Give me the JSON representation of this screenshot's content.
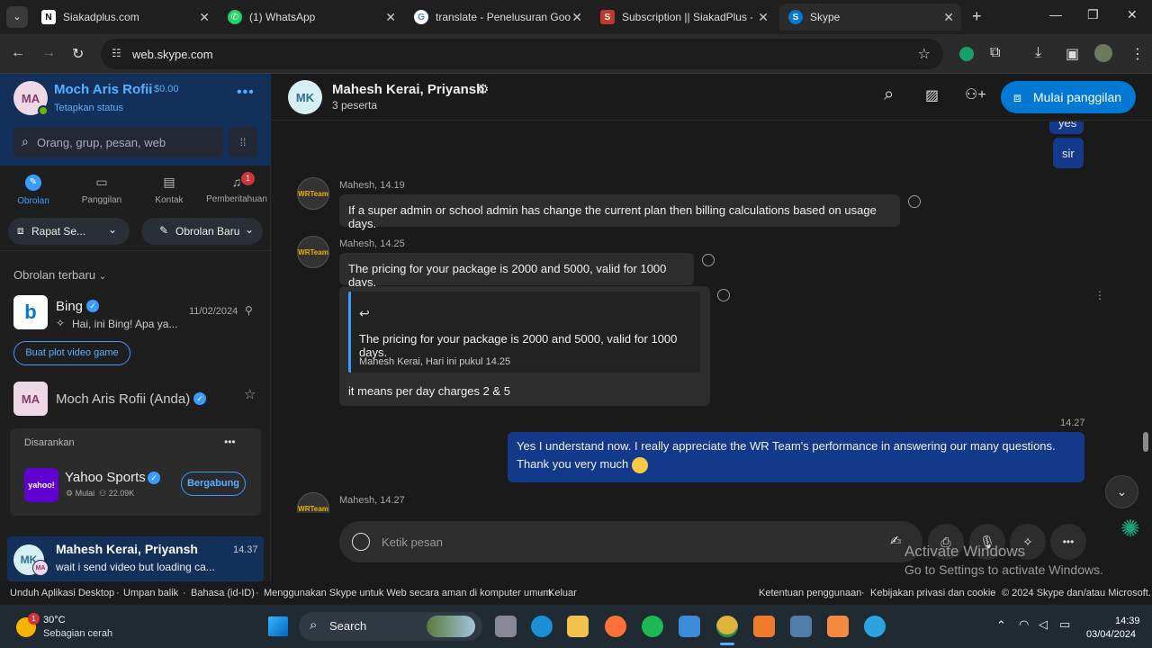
{
  "tabs": [
    {
      "title": "Siakadplus.com",
      "icon": "n-icon",
      "color": "#3a3a3a"
    },
    {
      "title": "(1) WhatsApp",
      "icon": "whatsapp-icon",
      "color": "#25d366"
    },
    {
      "title": "translate - Penelusuran Goo",
      "icon": "google-icon",
      "color": "#4285f4"
    },
    {
      "title": "Subscription || SiakadPlus - S",
      "icon": "siakad-icon",
      "color": "#c0392b"
    },
    {
      "title": "Skype",
      "icon": "skype-icon",
      "color": "#0078d4"
    }
  ],
  "url": "web.skype.com",
  "profile": {
    "initials": "MA",
    "name": "Moch Aris Rofii",
    "credit": "$0.00",
    "status": "Tetapkan status"
  },
  "search_placeholder": "Orang, grup, pesan, web",
  "nav": [
    {
      "label": "Obrolan",
      "icon": "chat-icon"
    },
    {
      "label": "Panggilan",
      "icon": "video-icon"
    },
    {
      "label": "Kontak",
      "icon": "contacts-icon"
    },
    {
      "label": "Pemberitahuan",
      "icon": "bell-icon",
      "badge": "1"
    }
  ],
  "meet_button": "Rapat Se...",
  "new_chat_button": "Obrolan Baru",
  "recent_header": "Obrolan terbaru",
  "bing": {
    "name": "Bing",
    "date": "11/02/2024",
    "preview": "Hai, ini Bing! Apa ya...",
    "chip": "Buat plot video game"
  },
  "self_chat": {
    "initials": "MA",
    "name": "Moch Aris Rofii (Anda)"
  },
  "suggested": {
    "header": "Disarankan",
    "name": "Yahoo Sports",
    "logo": "yahoo!",
    "sub1": "Mulai",
    "sub2": "22.09K",
    "join": "Bergabung"
  },
  "active_chat": {
    "initials": "MK",
    "sub_initials": "MA",
    "name": "Mahesh Kerai, Priyansh",
    "time": "14.37",
    "preview": "wait i send video but loading ca..."
  },
  "chat": {
    "initials": "MK",
    "title": "Mahesh Kerai, Priyansh",
    "participants": "3 peserta",
    "call_button": "Mulai panggilan"
  },
  "messages": {
    "top_out_partial": "yes",
    "top_out": "sir",
    "m1_meta": "Mahesh, 14.19",
    "m1_text": "If a super admin or school admin has change the current plan then billing calculations based on usage days.",
    "m2_meta": "Mahesh, 14.25",
    "m2_text": "The pricing for your package is 2000 and 5000, valid for 1000 days.",
    "quote_text": "The pricing for your package is 2000 and 5000, valid for 1000 days.",
    "quote_meta": "Mahesh Kerai, Hari ini pukul 14.25",
    "m3_text": "it means per day charges 2 & 5",
    "out_time": "14.27",
    "out_text": "Yes I understand now. I really appreciate the WR Team's performance in answering our many questions. Thank you very much",
    "m4_meta": "Mahesh, 14.27",
    "avatar_label": "WRTeam"
  },
  "compose_placeholder": "Ketik pesan",
  "watermark": {
    "line1": "Activate Windows",
    "line2": "Go to Settings to activate Windows."
  },
  "footer_left": [
    "Unduh Aplikasi Desktop",
    "Umpan balik",
    "Bahasa (id-ID)",
    "Menggunakan Skype untuk Web secara aman di komputer umum",
    "Keluar"
  ],
  "footer_right": [
    "Ketentuan penggunaan",
    "Kebijakan privasi dan cookie",
    "© 2024 Skype dan/atau Microsoft."
  ],
  "taskbar": {
    "weather_temp": "30°C",
    "weather_desc": "Sebagian cerah",
    "weather_badge": "1",
    "search": "Search",
    "time": "14:39",
    "date": "03/04/2024"
  }
}
